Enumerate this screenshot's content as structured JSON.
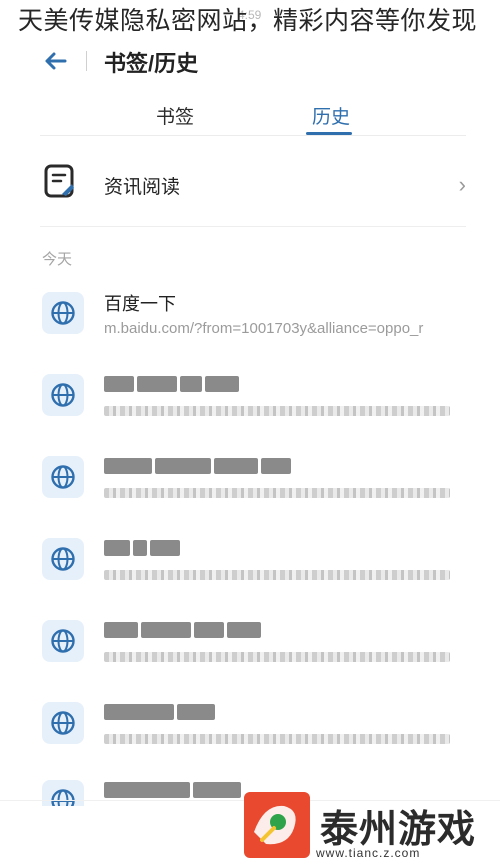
{
  "overlay_caption": "天美传媒隐私密网站，精彩内容等你发现",
  "status_bar": {
    "time": "4:59"
  },
  "header": {
    "title": "书签/历史"
  },
  "tabs": [
    {
      "label": "书签",
      "active": false
    },
    {
      "label": "历史",
      "active": true
    }
  ],
  "reading": {
    "label": "资讯阅读",
    "chevron": "›"
  },
  "history": {
    "section_label": "今天",
    "items": [
      {
        "title": "百度一下",
        "url": "m.baidu.com/?from=1001703y&alliance=oppo_r",
        "icon": "globe-icon"
      },
      {
        "title": "",
        "url": "",
        "icon": "globe-icon",
        "obscured": true
      },
      {
        "title": "",
        "url": "",
        "icon": "globe-icon",
        "obscured": true
      },
      {
        "title": "",
        "url": "",
        "icon": "globe-icon",
        "obscured": true
      },
      {
        "title": "",
        "url": "",
        "icon": "globe-icon",
        "obscured": true
      },
      {
        "title": "",
        "url": "",
        "icon": "globe-icon",
        "obscured": true
      },
      {
        "title": "",
        "url": "",
        "icon": "globe-icon",
        "obscured": true
      }
    ]
  },
  "watermark": {
    "text": "泰州游戏网",
    "url": "www.tianc.z.com"
  },
  "colors": {
    "accent": "#2f6fae",
    "tile_bg": "#e6f0fb",
    "muted": "#9b9b9b"
  }
}
